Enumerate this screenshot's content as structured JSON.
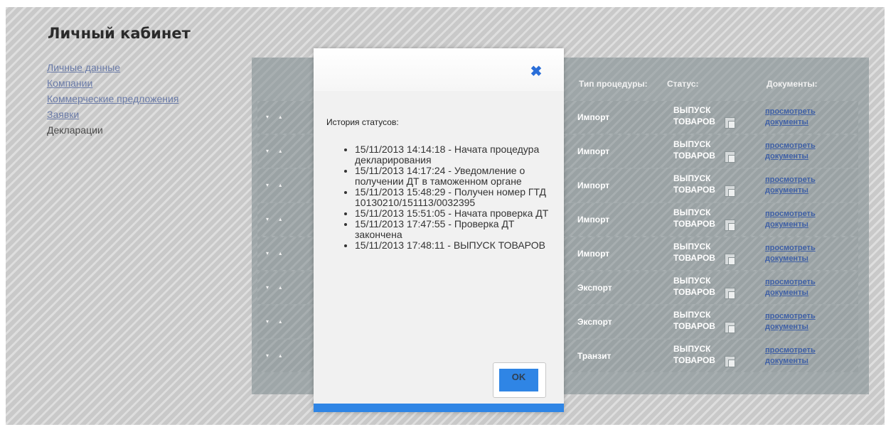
{
  "page": {
    "title": "Личный кабинет",
    "nav": [
      {
        "label": "Личные данные",
        "link": true
      },
      {
        "label": "Компании",
        "link": true
      },
      {
        "label": "Коммерческие предложения",
        "link": true
      },
      {
        "label": "Заявки",
        "link": true
      },
      {
        "label": "Декларации",
        "link": false
      }
    ]
  },
  "table": {
    "columns": {
      "procedure": "Тип процедуры:",
      "status": "Статус:",
      "documents": "Документы:"
    },
    "rows": [
      {
        "sort": "▾ ▴",
        "procedure": "Импорт",
        "status": "ВЫПУСК\nТОВАРОВ",
        "doc_link": "просмотреть\nдокументы"
      },
      {
        "sort": "▾ ▴",
        "procedure": "Импорт",
        "status": "ВЫПУСК\nТОВАРОВ",
        "doc_link": "просмотреть\nдокументы"
      },
      {
        "sort": "▾ ▴",
        "procedure": "Импорт",
        "status": "ВЫПУСК\nТОВАРОВ",
        "doc_link": "просмотреть\nдокументы"
      },
      {
        "sort": "▾ ▴",
        "procedure": "Импорт",
        "status": "ВЫПУСК\nТОВАРОВ",
        "doc_link": "просмотреть\nдокументы"
      },
      {
        "sort": "▾ ▴",
        "procedure": "Импорт",
        "status": "ВЫПУСК\nТОВАРОВ",
        "doc_link": "просмотреть\nдокументы"
      },
      {
        "sort": "▾ ▴",
        "procedure": "Экспорт",
        "status": "ВЫПУСК\nТОВАРОВ",
        "doc_link": "просмотреть\nдокументы"
      },
      {
        "sort": "▾ ▴",
        "procedure": "Экспорт",
        "status": "ВЫПУСК\nТОВАРОВ",
        "doc_link": "просмотреть\nдокументы"
      },
      {
        "sort": "▾ ▴",
        "procedure": "Транзит",
        "status": "ВЫПУСК\nТОВАРОВ",
        "doc_link": "просмотреть\nдокументы"
      }
    ]
  },
  "modal": {
    "close_icon": "✖",
    "heading": "История статусов:",
    "history": [
      "15/11/2013 14:14:18 - Начата процедура декларирования",
      "15/11/2013 14:17:24 - Уведомление о получении ДТ в таможенном органе",
      "15/11/2013 15:48:29 - Получен номер ГТД 10130210/151113/0032395",
      "15/11/2013 15:51:05 - Начата проверка ДТ",
      "15/11/2013 17:47:55 - Проверка ДТ закончена",
      "15/11/2013 17:48:11 - ВЫПУСК ТОВАРОВ"
    ],
    "ok_label": "OK"
  },
  "colors": {
    "accent": "#2f85e5",
    "link": "#6a7ba8",
    "panel": "#9ea6a8"
  }
}
